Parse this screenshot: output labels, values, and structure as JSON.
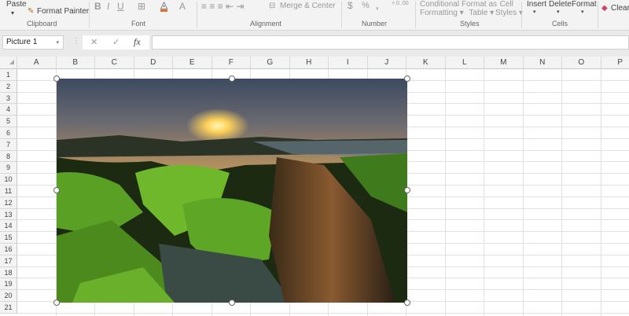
{
  "ribbon": {
    "clipboard": {
      "paste": "Paste",
      "format_painter": "Format Painter",
      "group": "Clipboard"
    },
    "font": {
      "bold": "B",
      "italic": "I",
      "underline": "U",
      "font_color": "A",
      "group": "Font"
    },
    "alignment": {
      "merge": "Merge & Center",
      "group": "Alignment"
    },
    "number": {
      "currency": "$",
      "percent": "%",
      "comma": ",",
      "group": "Number"
    },
    "styles": {
      "conditional": [
        "Conditional",
        "Formatting"
      ],
      "format_table": [
        "Format as",
        "Table"
      ],
      "cell_styles": [
        "Cell",
        "Styles"
      ],
      "group": "Styles"
    },
    "cells": {
      "insert": "Insert",
      "delete": "Delete",
      "format": "Format",
      "group": "Cells"
    },
    "editing": {
      "clear": "Clear"
    }
  },
  "formula_bar": {
    "name_box": "Picture 1",
    "cancel": "✕",
    "enter": "✓",
    "fx": "fx",
    "value": ""
  },
  "columns": [
    "A",
    "B",
    "C",
    "D",
    "E",
    "F",
    "G",
    "H",
    "I",
    "J",
    "K",
    "L",
    "M",
    "N",
    "O",
    "P"
  ],
  "rows": [
    "1",
    "2",
    "3",
    "4",
    "5",
    "6",
    "7",
    "8",
    "9",
    "10",
    "11",
    "12",
    "13",
    "14",
    "15",
    "16",
    "17",
    "18",
    "19",
    "20",
    "21"
  ],
  "picture": {
    "name": "Picture 1"
  }
}
